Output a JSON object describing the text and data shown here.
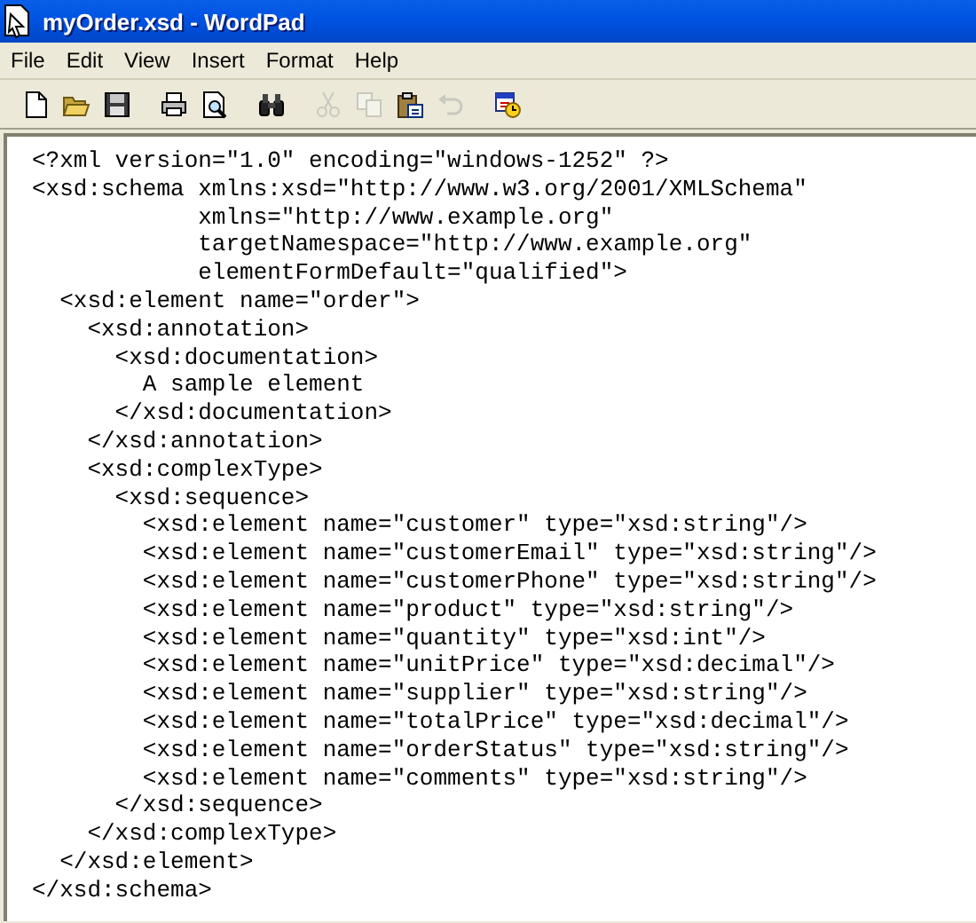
{
  "window": {
    "title": "myOrder.xsd - WordPad"
  },
  "menu": [
    "File",
    "Edit",
    "View",
    "Insert",
    "Format",
    "Help"
  ],
  "toolbar": [
    {
      "kind": "new",
      "disabled": false
    },
    {
      "kind": "open",
      "disabled": false
    },
    {
      "kind": "save",
      "disabled": false
    },
    {
      "kind": "print",
      "disabled": false
    },
    {
      "kind": "preview",
      "disabled": false
    },
    {
      "kind": "find",
      "disabled": false
    },
    {
      "kind": "cut",
      "disabled": true
    },
    {
      "kind": "copy",
      "disabled": true
    },
    {
      "kind": "paste",
      "disabled": false
    },
    {
      "kind": "undo",
      "disabled": true
    },
    {
      "kind": "datetime",
      "disabled": false
    }
  ],
  "document": {
    "lines": [
      "<?xml version=\"1.0\" encoding=\"windows-1252\" ?>",
      "<xsd:schema xmlns:xsd=\"http://www.w3.org/2001/XMLSchema\"",
      "            xmlns=\"http://www.example.org\"",
      "            targetNamespace=\"http://www.example.org\"",
      "            elementFormDefault=\"qualified\">",
      "  <xsd:element name=\"order\">",
      "    <xsd:annotation>",
      "      <xsd:documentation>",
      "        A sample element",
      "      </xsd:documentation>",
      "    </xsd:annotation>",
      "    <xsd:complexType>",
      "      <xsd:sequence>",
      "        <xsd:element name=\"customer\" type=\"xsd:string\"/>",
      "        <xsd:element name=\"customerEmail\" type=\"xsd:string\"/>",
      "        <xsd:element name=\"customerPhone\" type=\"xsd:string\"/>",
      "        <xsd:element name=\"product\" type=\"xsd:string\"/>",
      "        <xsd:element name=\"quantity\" type=\"xsd:int\"/>",
      "        <xsd:element name=\"unitPrice\" type=\"xsd:decimal\"/>",
      "        <xsd:element name=\"supplier\" type=\"xsd:string\"/>",
      "        <xsd:element name=\"totalPrice\" type=\"xsd:decimal\"/>",
      "        <xsd:element name=\"orderStatus\" type=\"xsd:string\"/>",
      "        <xsd:element name=\"comments\" type=\"xsd:string\"/>",
      "      </xsd:sequence>",
      "    </xsd:complexType>",
      "  </xsd:element>",
      "</xsd:schema>"
    ]
  }
}
